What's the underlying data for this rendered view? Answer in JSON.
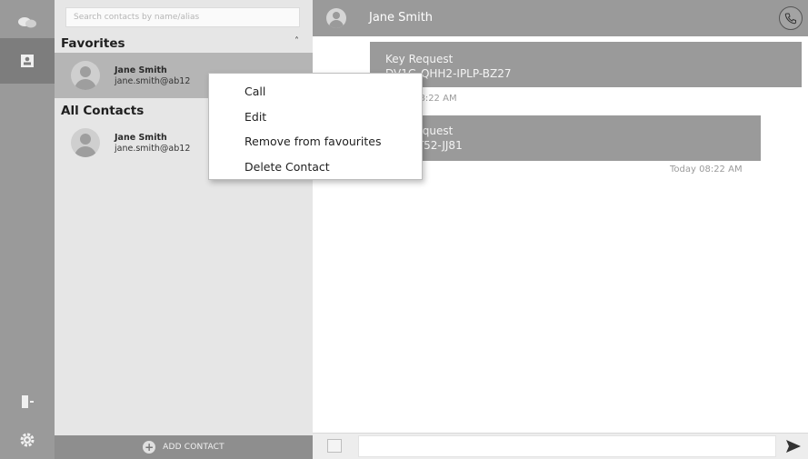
{
  "rail": {
    "icons": [
      "chat-bubbles-icon",
      "contacts-icon",
      "logout-icon",
      "settings-gear-icon"
    ]
  },
  "contacts": {
    "search_placeholder": "Search contacts by name/alias",
    "favorites_heading": "Favorites",
    "all_contacts_heading": "All Contacts",
    "favorites": [
      {
        "name": "Jane Smith",
        "email": "jane.smith@ab12"
      }
    ],
    "all_contacts": [
      {
        "name": "Jane Smith",
        "email": "jane.smith@ab12"
      }
    ],
    "add_contact_label": "ADD CONTACT"
  },
  "chat": {
    "contact_name": "Jane Smith",
    "messages": [
      {
        "title": "Key Request",
        "body": "DV1G-QHH2-IPLP-BZ27",
        "time": "Today 08:22 AM"
      },
      {
        "title": "Key Request",
        "body": "X-BT52-JJ81",
        "time": "Today 08:22 AM"
      }
    ]
  },
  "context_menu": {
    "items": [
      "Call",
      "Edit",
      "Remove from favourites",
      "Delete Contact"
    ]
  },
  "colors": {
    "rail": "#9a9a9a",
    "panel": "#e6e6e6",
    "bubble": "#9a9a9a",
    "selected_row": "#b5b5b5"
  }
}
